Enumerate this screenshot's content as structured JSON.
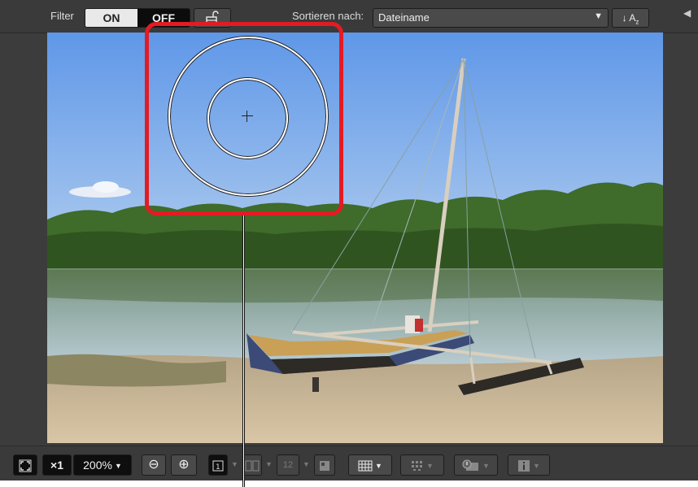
{
  "topbar": {
    "filter_label": "Filter",
    "filter_on": "ON",
    "filter_off": "OFF",
    "sort_label": "Sortieren nach:",
    "sort_value": "Dateiname",
    "sort_order_arrow": "↓",
    "sort_order_letters": "A",
    "sort_order_sub": "z"
  },
  "bottombar": {
    "zoom_one": "×1",
    "zoom_level": "200%",
    "zoom_out_symbol": "⊖",
    "zoom_in_symbol": "⊕",
    "compare_1": "1",
    "compare_2": "12"
  },
  "colors": {
    "highlight": "#e31b23",
    "toolbar": "#3a3a3a"
  }
}
